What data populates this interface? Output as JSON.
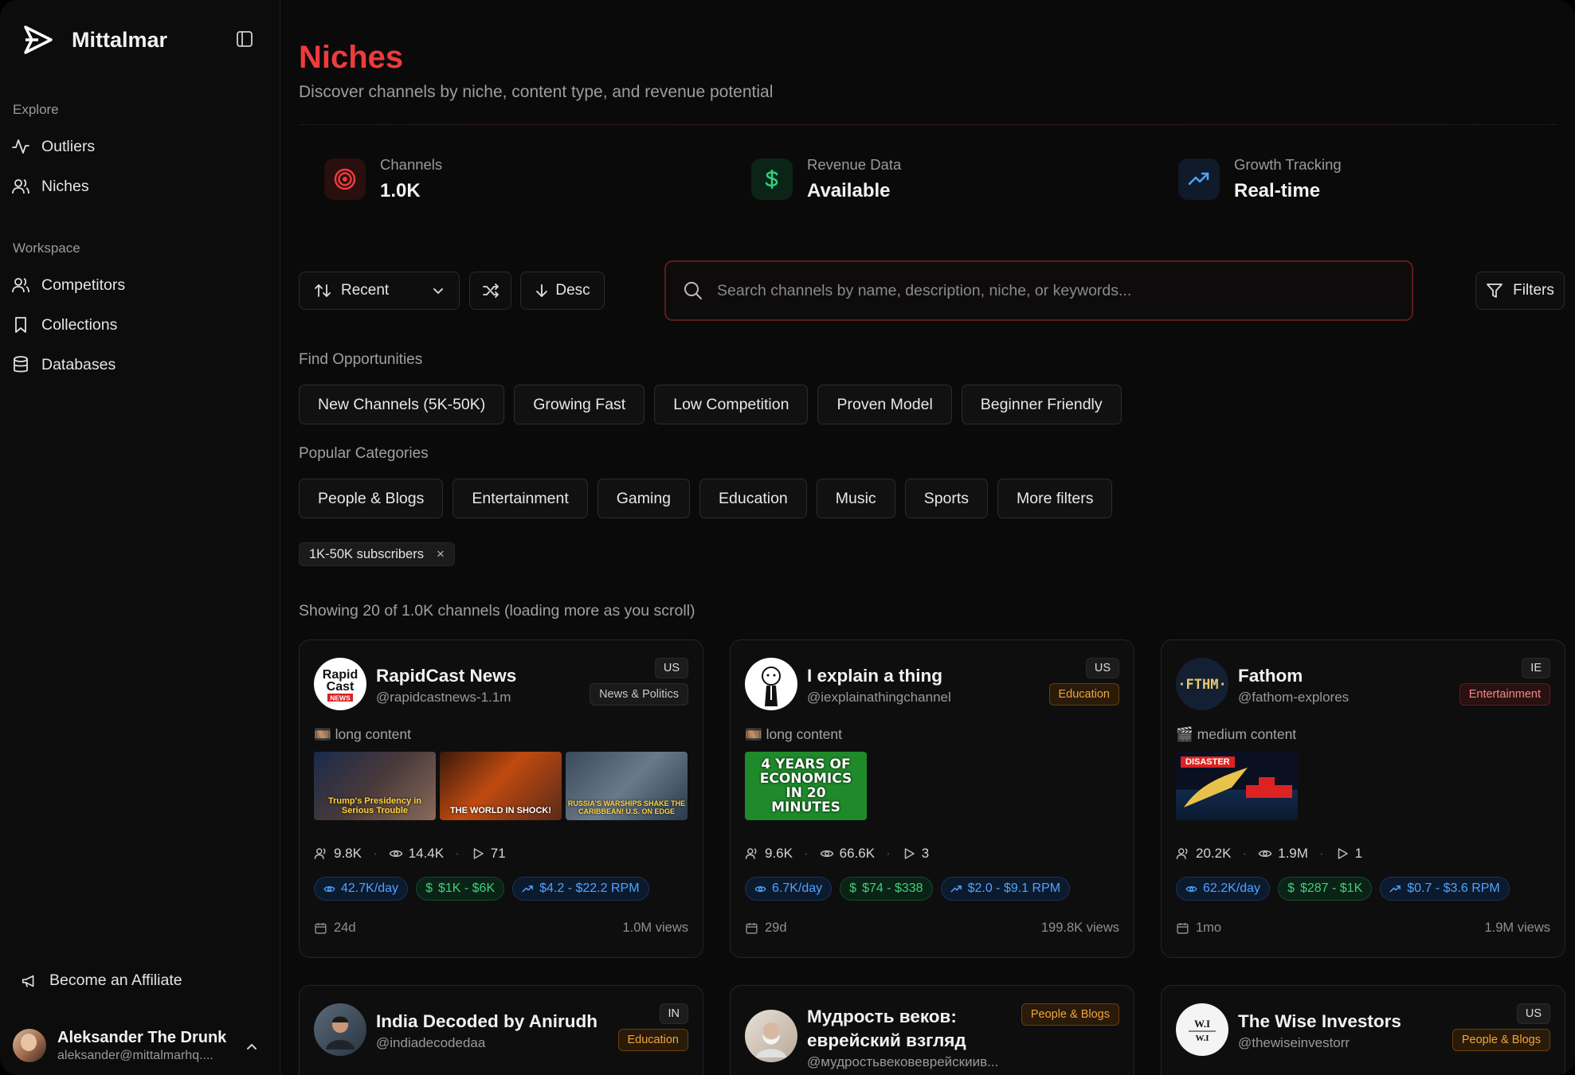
{
  "app": {
    "name": "Mittalmar"
  },
  "sidebar": {
    "explore_label": "Explore",
    "explore_items": [
      {
        "label": "Outliers"
      },
      {
        "label": "Niches"
      }
    ],
    "workspace_label": "Workspace",
    "workspace_items": [
      {
        "label": "Competitors"
      },
      {
        "label": "Collections"
      },
      {
        "label": "Databases"
      }
    ],
    "affiliate_label": "Become an Affiliate",
    "user": {
      "name": "Aleksander The Drunk",
      "email": "aleksander@mittalmarhq...."
    }
  },
  "page": {
    "title": "Niches",
    "subtitle": "Discover channels by niche, content type, and revenue potential"
  },
  "stats": [
    {
      "label": "Channels",
      "value": "1.0K",
      "icon": "target-icon",
      "color": "#ef3b3b"
    },
    {
      "label": "Revenue Data",
      "value": "Available",
      "icon": "dollar-icon",
      "color": "#2fd17a"
    },
    {
      "label": "Growth Tracking",
      "value": "Real-time",
      "icon": "trending-up-icon",
      "color": "#4da3ff"
    }
  ],
  "controls": {
    "sort_label": "Recent",
    "order_label": "Desc",
    "search_placeholder": "Search channels by name, description, niche, or keywords...",
    "filters_label": "Filters"
  },
  "opportunities": {
    "heading": "Find Opportunities",
    "chips": [
      "New Channels (5K-50K)",
      "Growing Fast",
      "Low Competition",
      "Proven Model",
      "Beginner Friendly"
    ]
  },
  "categories": {
    "heading": "Popular Categories",
    "chips": [
      "People & Blogs",
      "Entertainment",
      "Gaming",
      "Education",
      "Music",
      "Sports",
      "More filters"
    ]
  },
  "active_filter": {
    "label": "1K-50K subscribers",
    "remove": "×"
  },
  "results_text": "Showing 20 of 1.0K channels (loading more as you scroll)",
  "cards": [
    {
      "name": "RapidCast News",
      "handle": "@rapidcastnews-1.1m",
      "country": "US",
      "niche": "News & Politics",
      "content_type": "long content",
      "thumbs": [
        "Trump's Presidency in Serious Trouble",
        "THE WORLD IN SHOCK!",
        "RUSSIA'S WARSHIPS SHAKE THE CARIBBEAN! U.S. ON EDGE"
      ],
      "subs": "9.8K",
      "avg_views": "14.4K",
      "videos": "71",
      "views_day": "42.7K/day",
      "revenue": "$1K - $6K",
      "rpm": "$4.2 - $22.2 RPM",
      "age": "24d",
      "total_views": "1.0M views"
    },
    {
      "name": "I explain a thing",
      "handle": "@iexplainathingchannel",
      "country": "US",
      "niche": "Education",
      "content_type": "long content",
      "thumbs": [
        "4 YEARS OF ECONOMICS IN 20 MINUTES"
      ],
      "subs": "9.6K",
      "avg_views": "66.6K",
      "videos": "3",
      "views_day": "6.7K/day",
      "revenue": "$74 - $338",
      "rpm": "$2.0 - $9.1 RPM",
      "age": "29d",
      "total_views": "199.8K views"
    },
    {
      "name": "Fathom",
      "handle": "@fathom-explores",
      "country": "IE",
      "niche": "Entertainment",
      "content_type": "medium content",
      "thumbs": [
        "DISASTER"
      ],
      "subs": "20.2K",
      "avg_views": "1.9M",
      "videos": "1",
      "views_day": "62.2K/day",
      "revenue": "$287 - $1K",
      "rpm": "$0.7 - $3.6 RPM",
      "age": "1mo",
      "total_views": "1.9M views"
    },
    {
      "name": "India Decoded by Anirudh",
      "handle": "@indiadecodedaa",
      "country": "IN",
      "niche": "Education"
    },
    {
      "name": "Мудрость веков: еврейский взгляд",
      "handle": "@мудростьвековеврейскиив...",
      "country": "",
      "niche": "People & Blogs"
    },
    {
      "name": "The Wise Investors",
      "handle": "@thewiseinvestorr",
      "country": "US",
      "niche": "People & Blogs"
    }
  ]
}
